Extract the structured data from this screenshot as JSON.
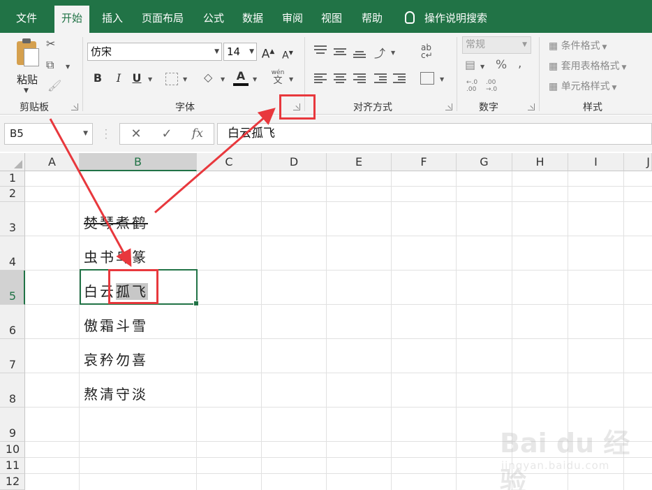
{
  "menu": {
    "tabs": [
      {
        "label": "文件",
        "active": false
      },
      {
        "label": "开始",
        "active": true
      },
      {
        "label": "插入",
        "active": false
      },
      {
        "label": "页面布局",
        "active": false
      },
      {
        "label": "公式",
        "active": false
      },
      {
        "label": "数据",
        "active": false
      },
      {
        "label": "审阅",
        "active": false
      },
      {
        "label": "视图",
        "active": false
      },
      {
        "label": "帮助",
        "active": false
      }
    ],
    "tell_me": "操作说明搜索"
  },
  "ribbon": {
    "clipboard": {
      "group_label": "剪贴板",
      "paste_label": "粘贴"
    },
    "font": {
      "group_label": "字体",
      "font_name": "仿宋",
      "font_size": "14",
      "bold": "B",
      "italic": "I",
      "underline": "U",
      "grow": "A",
      "shrink": "A",
      "font_color": "A",
      "phonetic_top": "wén",
      "phonetic_bottom": "文"
    },
    "alignment": {
      "group_label": "对齐方式"
    },
    "number": {
      "group_label": "数字",
      "format": "常规",
      "percent": "%",
      "comma": ","
    },
    "styles": {
      "group_label": "样式",
      "conditional": "条件格式",
      "table_format": "套用表格格式",
      "cell_styles": "单元格样式"
    }
  },
  "formula_bar": {
    "name_box": "B5",
    "cancel": "✕",
    "enter": "✓",
    "fx": "fx",
    "content": "白云孤飞"
  },
  "sheet": {
    "columns": [
      "A",
      "B",
      "C",
      "D",
      "E",
      "F",
      "G",
      "H",
      "I",
      "J"
    ],
    "selected_column": "B",
    "rows": [
      "1",
      "2",
      "3",
      "4",
      "5",
      "6",
      "7",
      "8",
      "9",
      "10",
      "11",
      "12"
    ],
    "selected_row": "5",
    "cells": {
      "B3": "焚琴煮鹤",
      "B4": "虫书鸟篆",
      "B5_plain": "白云",
      "B5_highlighted": "孤飞",
      "B6": "傲霜斗雪",
      "B7": "哀矜勿喜",
      "B8": "熬清守淡"
    }
  },
  "watermark": {
    "logo": "Bai du 经验",
    "url": "jingyan.baidu.com"
  },
  "colors": {
    "excel_green": "#217346",
    "annotation_red": "#e8383d"
  }
}
